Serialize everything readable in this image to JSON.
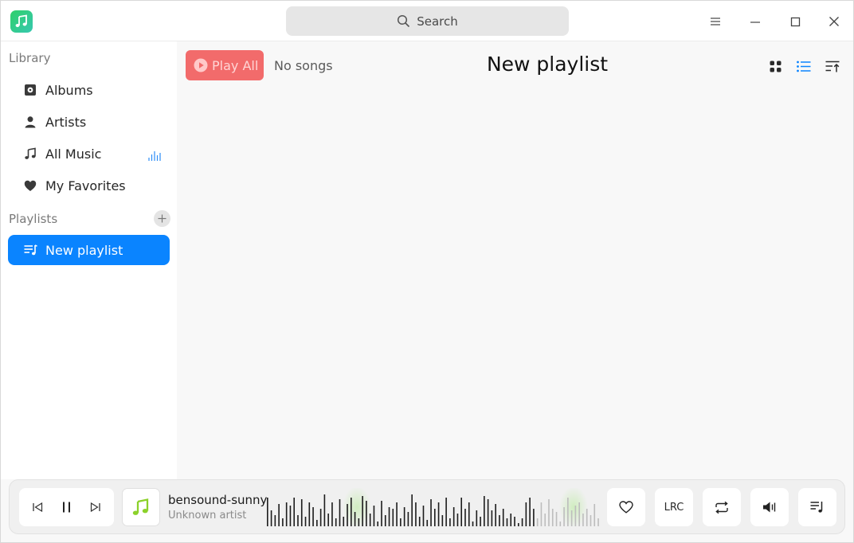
{
  "titlebar": {
    "app_icon": "music-note-icon",
    "search_placeholder": "Search",
    "window_buttons": [
      "menu-icon",
      "minimize-icon",
      "maximize-icon",
      "close-icon"
    ]
  },
  "sidebar": {
    "library_label": "Library",
    "library_items": [
      {
        "label": "Albums",
        "icon": "album-icon"
      },
      {
        "label": "Artists",
        "icon": "artist-icon"
      },
      {
        "label": "All Music",
        "icon": "music-note-icon",
        "playing_indicator": "equalizer-icon"
      },
      {
        "label": "My Favorites",
        "icon": "heart-icon"
      }
    ],
    "playlists_label": "Playlists",
    "playlists": [
      {
        "label": "New playlist",
        "icon": "playlist-icon",
        "active": true
      }
    ]
  },
  "main": {
    "play_all_label": "Play All",
    "song_count": "No songs",
    "title": "New playlist",
    "view_modes": [
      "grid-view-icon",
      "list-view-icon",
      "sort-icon"
    ],
    "active_view": "list-view-icon"
  },
  "player": {
    "track_title": "bensound-sunny",
    "track_artist": "Unknown artist",
    "progress": 0.81,
    "lyrics_label": "LRC",
    "is_playing": true
  },
  "colors": {
    "accent": "#0a84ff",
    "play_all": "#f26b6b",
    "logo_green": "#2fd06a",
    "cover_note": "#8bd12a"
  }
}
